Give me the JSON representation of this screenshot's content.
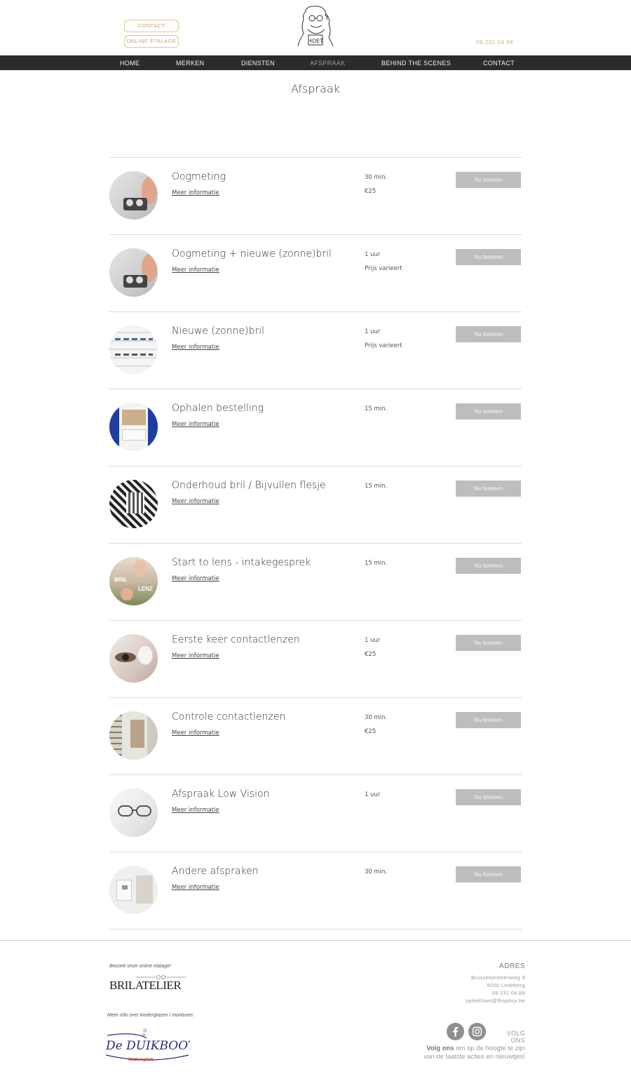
{
  "header": {
    "contact_button": "CONTACT",
    "etalage_button": "ONLINE ETALAGE",
    "logo_text": "HOET",
    "phone": "09 231 04 88"
  },
  "nav": {
    "items": [
      "HOME",
      "MERKEN",
      "DIENSTEN",
      "AFSPRAAK",
      "BEHIND THE SCENES",
      "CONTACT"
    ],
    "active": "AFSPRAAK"
  },
  "page_title": "Afspraak",
  "services": [
    {
      "name": "Oogmeting",
      "more": "Meer informatie",
      "duration": "30 min.",
      "price": "€25",
      "book": "Nu boeken",
      "thumb": "eye-exam"
    },
    {
      "name": "Oogmeting + nieuwe (zonne)bril",
      "more": "Meer informatie",
      "duration": "1 uur",
      "price": "Prijs varieert",
      "book": "Nu boeken",
      "thumb": "eye-exam"
    },
    {
      "name": "Nieuwe (zonne)bril",
      "more": "Meer informatie",
      "duration": "1 uur",
      "price": "Prijs varieert",
      "book": "Nu boeken",
      "thumb": "glasses-wall"
    },
    {
      "name": "Ophalen bestelling",
      "more": "Meer informatie",
      "duration": "15 min.",
      "price": "",
      "book": "Nu boeken",
      "thumb": "store"
    },
    {
      "name": "Onderhoud bril / Bijvullen flesje",
      "more": "Meer informatie",
      "duration": "15 min.",
      "price": "",
      "book": "Nu boeken",
      "thumb": "bw-pattern"
    },
    {
      "name": "Start to lens - intakegesprek",
      "more": "Meer informatie",
      "duration": "15 min.",
      "price": "",
      "book": "Nu boeken",
      "thumb": "bril-lenz"
    },
    {
      "name": "Eerste keer contactlenzen",
      "more": "Meer informatie",
      "duration": "1 uur",
      "price": "€25",
      "book": "Nu boeken",
      "thumb": "eye-closeup"
    },
    {
      "name": "Controle contactlenzen",
      "more": "Meer informatie",
      "duration": "30 min.",
      "price": "€25",
      "book": "Nu boeken",
      "thumb": "shop-interior"
    },
    {
      "name": "Afspraak Low Vision",
      "more": "Meer informatie",
      "duration": "1 uur",
      "price": "",
      "book": "Nu boeken",
      "thumb": "glasses-on-book"
    },
    {
      "name": "Andere afspraken",
      "more": "Meer informatie",
      "duration": "30 min.",
      "price": "",
      "book": "Nu boeken",
      "thumb": "white-room"
    }
  ],
  "thumb_labels": {
    "bril": "BRIL",
    "lenz": "LENZ"
  },
  "footer": {
    "etalage_note": "Bezoek onze online etalage!",
    "bril_logo": "BRILATELIER",
    "kids_note": "Meer info over kinderglazen / monturen:",
    "duik_logo": "De DUIKBOOT",
    "duik_sub": "kinderoptiek",
    "address_title": "ADRES",
    "address_lines": [
      "Brusselsesteenweg 8",
      "9050 Ledeberg",
      "09 231 04 88",
      "optiekhoet@fhoptics.be"
    ],
    "follow_label": "VOLG ONS",
    "follow_bold": "Volg ons",
    "follow_rest": " om op de hoogte te zijn",
    "follow_line2": "van de laatste acties en nieuwtjes!",
    "colors": {
      "accent": "#c9a36a",
      "nav_bg": "#2b2b2b",
      "button": "#bdbdbd"
    }
  }
}
